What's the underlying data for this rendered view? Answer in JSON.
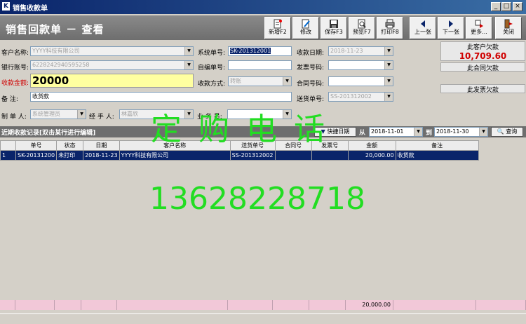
{
  "window": {
    "icon": "K",
    "title": "销售收款单",
    "controls": [
      "_",
      "□",
      "×"
    ]
  },
  "header": {
    "title": "销售回款单 － 查看"
  },
  "toolbar": [
    {
      "label": "新增F2",
      "icon": "new-doc-icon"
    },
    {
      "label": "修改",
      "icon": "edit-icon"
    },
    {
      "label": "保存F3",
      "icon": "save-icon"
    },
    {
      "label": "预览F7",
      "icon": "preview-icon"
    },
    {
      "label": "打印F8",
      "icon": "print-icon"
    },
    {
      "label": "上一张",
      "icon": "arrow-left-icon"
    },
    {
      "label": "下一张",
      "icon": "arrow-right-icon"
    },
    {
      "label": "更多...",
      "icon": "more-icon"
    },
    {
      "label": "关闭",
      "icon": "exit-icon"
    }
  ],
  "form": {
    "customer_label": "客户名称:",
    "customer_value": "YYYY科技有限公司",
    "bank_label": "银行账号:",
    "bank_value": "6228242940595258",
    "amount_label": "收款金额:",
    "amount_value": "20000",
    "remark_label": "备    注:",
    "remark_value": "收货款",
    "maker_label": "制 单 人:",
    "maker_value": "系统管理员",
    "handler_label": "经 手 人:",
    "handler_value": "林嘉欣",
    "sales_label": "业 务 员:",
    "sales_value": "",
    "sysno_label": "系统单号:",
    "sysno_value": "SK-201312001",
    "selfno_label": "自编单号:",
    "selfno_value": "",
    "method_label": "收款方式:",
    "method_value": "转账",
    "date_label": "收款日期:",
    "date_value": "2018-11-23",
    "invoice_label": "发票号码:",
    "invoice_value": "",
    "contract_label": "合同号码:",
    "contract_value": "",
    "delivery_label": "送货单号:",
    "delivery_value": "SS-201312002"
  },
  "side": {
    "owed_label": "此客户欠款",
    "owed_value": "10,709.60",
    "contract_owed_label": "此合同欠款",
    "invoice_owed_label": "此发票欠款"
  },
  "records": {
    "title": "近期收款记录[双击某行进行编辑]",
    "quick_date": "快捷日期",
    "from_label": "从",
    "from_date": "2018-11-01",
    "to_label": "到",
    "to_date": "2018-11-30",
    "query_label": "查询",
    "columns": [
      "",
      "单号",
      "状态",
      "日期",
      "客户名称",
      "送货单号",
      "合同号",
      "发票号",
      "金额",
      "备注"
    ],
    "rows": [
      [
        "1",
        "SK-20131200",
        "未打印",
        "2018-11-23",
        "YYYY科技有限公司",
        "SS-201312002",
        "",
        "",
        "20,000.00",
        "收货款"
      ]
    ],
    "total_amount": "20,000.00"
  },
  "watermark": {
    "line1": "定购电话",
    "line2": "13628228718"
  },
  "colors": {
    "title_blue": "#0a246a",
    "header_gray": "#6e6e6e",
    "warn_red": "#d00000",
    "watermark_green": "#22dd22",
    "selected_row": "#0a246a",
    "footer_pink": "#f2c8d8"
  }
}
